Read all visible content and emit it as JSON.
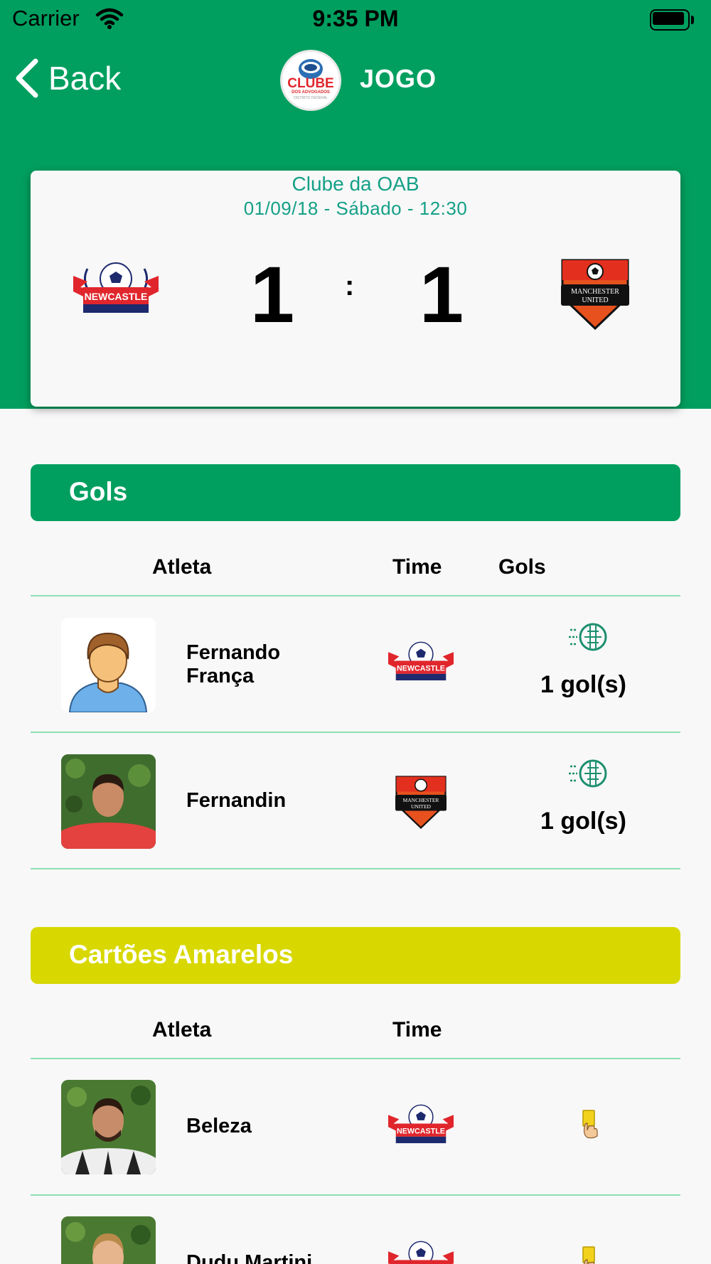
{
  "status_bar": {
    "carrier": "Carrier",
    "time": "9:35 PM"
  },
  "nav": {
    "back_label": "Back",
    "title": "JOGO",
    "logo_text": "CLUBE",
    "logo_subtext": "DOS ADVOGADOS",
    "logo_subtext2": "DISTRITO FEDERAL"
  },
  "match": {
    "venue": "Clube da OAB",
    "datetime": "01/09/18 - Sábado - 12:30",
    "home_team": "NEWCASTLE",
    "away_team_line1": "MANCHESTER",
    "away_team_line2": "UNITED",
    "home_score": "1",
    "away_score": "1",
    "separator": ":"
  },
  "goals": {
    "title": "Gols",
    "headers": {
      "athlete": "Atleta",
      "team": "Time",
      "goals": "Gols"
    },
    "rows": [
      {
        "name_line1": "Fernando",
        "name_line2": "França",
        "team": "newcastle",
        "goals": "1 gol(s)"
      },
      {
        "name": "Fernandin",
        "team": "manchester-united",
        "goals": "1 gol(s)"
      }
    ]
  },
  "yellow_cards": {
    "title": "Cartões Amarelos",
    "headers": {
      "athlete": "Atleta",
      "team": "Time"
    },
    "rows": [
      {
        "name": "Beleza",
        "team": "newcastle"
      },
      {
        "name": "Dudu Martini",
        "team": "newcastle"
      }
    ]
  },
  "colors": {
    "primary_green": "#009f5f",
    "yellow_bar": "#d8d800",
    "teal_text": "#15a087",
    "divider": "#8de0b4"
  },
  "icons": [
    "wifi-icon",
    "battery-icon",
    "back-chevron-icon",
    "soccer-ball-icon",
    "yellow-card-icon"
  ]
}
